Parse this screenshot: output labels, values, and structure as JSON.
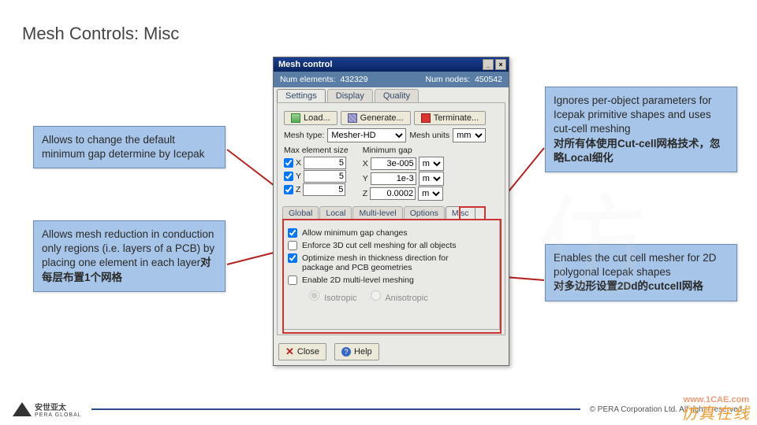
{
  "slide": {
    "title": "Mesh Controls: Misc"
  },
  "callouts": {
    "tl": "Allows to change the default minimum gap determine by Icepak",
    "bl_a": "Allows mesh reduction in conduction only regions (i.e. layers of a PCB) by placing one element in each layer",
    "bl_b": "对每层布置1个网格",
    "tr_a": "Ignores per-object parameters for Icepak primitive shapes and uses cut-cell meshing",
    "tr_b": "对所有体使用Cut-cell网格技术，忽略Local细化",
    "br_a": "Enables the cut cell mesher for 2D polygonal Icepak shapes",
    "br_b": "对多边形设置2Dd的cutcell网格"
  },
  "dialog": {
    "title": "Mesh control",
    "info": {
      "num_el_label": "Num elements:",
      "num_el": "432329",
      "num_nodes_label": "Num nodes:",
      "num_nodes": "450542"
    },
    "tabs": [
      "Settings",
      "Display",
      "Quality"
    ],
    "toolbar": {
      "load": "Load...",
      "generate": "Generate...",
      "terminate": "Terminate..."
    },
    "meshtype_label": "Mesh type:",
    "meshtype_value": "Mesher-HD",
    "meshunits_label": "Mesh units",
    "meshunits_value": "mm",
    "max_el_label": "Max element size",
    "min_gap_label": "Minimum gap",
    "max": {
      "x": {
        "lbl": "X",
        "val": "5"
      },
      "y": {
        "lbl": "Y",
        "val": "5"
      },
      "z": {
        "lbl": "Z",
        "val": "5"
      }
    },
    "min": {
      "x": {
        "lbl": "X",
        "val": "3e-005",
        "u": "m"
      },
      "y": {
        "lbl": "Y",
        "val": "1e-3",
        "u": "m"
      },
      "z": {
        "lbl": "Z",
        "val": "0.0002",
        "u": "m"
      }
    },
    "subtabs": [
      "Global",
      "Local",
      "Multi-level",
      "Options",
      "Misc"
    ],
    "misc": {
      "allow": "Allow minimum gap changes",
      "enforce": "Enforce 3D cut cell meshing for all objects",
      "optimize": "Optimize mesh in thickness direction for package and PCB geometries",
      "enable2d": "Enable 2D multi-level meshing",
      "iso": "Isotropic",
      "aniso": "Anisotropic"
    },
    "footer": {
      "close": "Close",
      "help": "Help"
    }
  },
  "page_footer": {
    "brand_cn": "安世亚太",
    "brand_en": "PERA GLOBAL",
    "copyright": "©   PERA Corporation Ltd. All rights reserved.",
    "wm": "仿真在线",
    "wmurl": "www.1CAE.com"
  }
}
